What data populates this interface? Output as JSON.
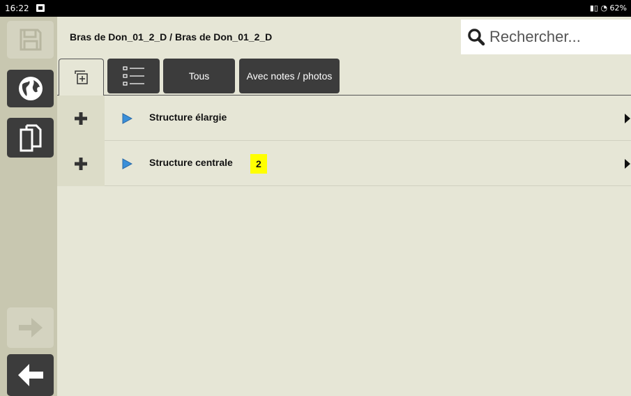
{
  "status_bar": {
    "time": "16:22",
    "right_text": "62%"
  },
  "header": {
    "breadcrumb": "Bras de Don_01_2_D / Bras de Don_01_2_D",
    "search_placeholder": "Rechercher..."
  },
  "toolbar": {
    "btn_all": "Tous",
    "btn_notes": "Avec notes / photos"
  },
  "rows": [
    {
      "label": "Structure élargie",
      "badge": ""
    },
    {
      "label": "Structure centrale",
      "badge": "2"
    }
  ],
  "icons": {
    "sidebar": [
      "save-icon",
      "globe-icon",
      "copy-icon",
      "forward-arrow-icon",
      "back-arrow-icon"
    ],
    "toolbar": [
      "expand-all-icon",
      "list-view-icon"
    ],
    "row": [
      "plus-icon",
      "play-icon",
      "chevron-right-icon"
    ]
  },
  "colors": {
    "background": "#e6e6d6",
    "sidebar": "#c8c7b0",
    "dark_button": "#3c3c3c",
    "badge": "#ffff00",
    "play_icon": "#3a8fd9"
  }
}
